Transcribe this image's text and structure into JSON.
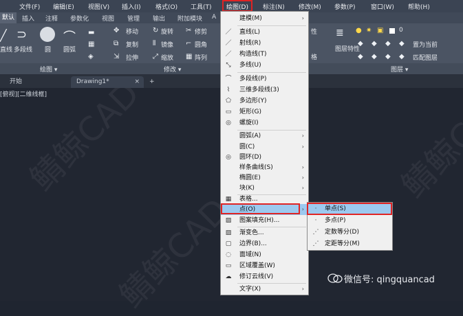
{
  "menubar": {
    "items": [
      "文件(F)",
      "编辑(E)",
      "视图(V)",
      "插入(I)",
      "格式(O)",
      "工具(T)",
      "绘图(D)",
      "标注(N)",
      "修改(M)",
      "参数(P)",
      "窗口(W)",
      "帮助(H)"
    ],
    "active": "绘图(D)"
  },
  "ribbon_tabs": [
    "默认",
    "插入",
    "注释",
    "参数化",
    "视图",
    "管理",
    "输出",
    "附加模块",
    "A"
  ],
  "ribbon": {
    "draw_tools": [
      "直线",
      "多段线",
      "圆",
      "圆弧"
    ],
    "modify_tools": [
      "移动",
      "旋转",
      "修剪",
      "复制",
      "镜像",
      "圆角",
      "拉伸",
      "缩放",
      "阵列"
    ],
    "layer_tools": [
      "图层特性",
      "置为当前",
      "匹配图层"
    ],
    "layer_value": "0",
    "panel_titles": [
      "绘图 ▾",
      "修改 ▾",
      "图层 ▾"
    ],
    "extra_labels": [
      "性",
      "格"
    ]
  },
  "doc_tabs": {
    "start": "开始",
    "drawing": "Drawing1*",
    "close": "×",
    "add": "+"
  },
  "viewport_label": "[俯视][二维线框]",
  "draw_menu": {
    "items": [
      {
        "icon": "",
        "label": "建模(M)",
        "arrow": "›"
      },
      {
        "icon": "／",
        "label": "直线(L)",
        "arrow": ""
      },
      {
        "icon": "／",
        "label": "射线(R)",
        "arrow": ""
      },
      {
        "icon": "／",
        "label": "构造线(T)",
        "arrow": ""
      },
      {
        "icon": "⤡",
        "label": "多线(U)",
        "arrow": ""
      },
      {
        "icon": "⌒",
        "label": "多段线(P)",
        "arrow": ""
      },
      {
        "icon": "⌇",
        "label": "三维多段线(3)",
        "arrow": ""
      },
      {
        "icon": "⬠",
        "label": "多边形(Y)",
        "arrow": ""
      },
      {
        "icon": "▭",
        "label": "矩形(G)",
        "arrow": ""
      },
      {
        "icon": "◎",
        "label": "螺旋(I)",
        "arrow": ""
      },
      {
        "icon": "",
        "label": "圆弧(A)",
        "arrow": "›"
      },
      {
        "icon": "",
        "label": "圆(C)",
        "arrow": "›"
      },
      {
        "icon": "◎",
        "label": "圆环(D)",
        "arrow": ""
      },
      {
        "icon": "",
        "label": "样条曲线(S)",
        "arrow": "›"
      },
      {
        "icon": "",
        "label": "椭圆(E)",
        "arrow": "›"
      },
      {
        "icon": "",
        "label": "块(K)",
        "arrow": "›"
      },
      {
        "icon": "▦",
        "label": "表格...",
        "arrow": ""
      },
      {
        "icon": "",
        "label": "点(O)",
        "arrow": "›"
      },
      {
        "icon": "▨",
        "label": "图案填充(H)...",
        "arrow": ""
      },
      {
        "icon": "▨",
        "label": "渐变色...",
        "arrow": ""
      },
      {
        "icon": "▢",
        "label": "边界(B)...",
        "arrow": ""
      },
      {
        "icon": "◌",
        "label": "面域(N)",
        "arrow": ""
      },
      {
        "icon": "▭",
        "label": "区域覆盖(W)",
        "arrow": ""
      },
      {
        "icon": "☁",
        "label": "修订云线(V)",
        "arrow": ""
      },
      {
        "icon": "",
        "label": "文字(X)",
        "arrow": "›"
      }
    ]
  },
  "point_submenu": {
    "items": [
      {
        "icon": "·",
        "label": "单点(S)"
      },
      {
        "icon": "·",
        "label": "多点(P)"
      },
      {
        "icon": "⋰",
        "label": "定数等分(D)"
      },
      {
        "icon": "⋰",
        "label": "定距等分(M)"
      }
    ]
  },
  "watermark": "鲭鲸CAD",
  "wechat": "微信号: qingquancad",
  "colors": {
    "highlight_border": "#e02424",
    "menu_selection": "#9cc9ef",
    "dark_bg": "#212631"
  }
}
